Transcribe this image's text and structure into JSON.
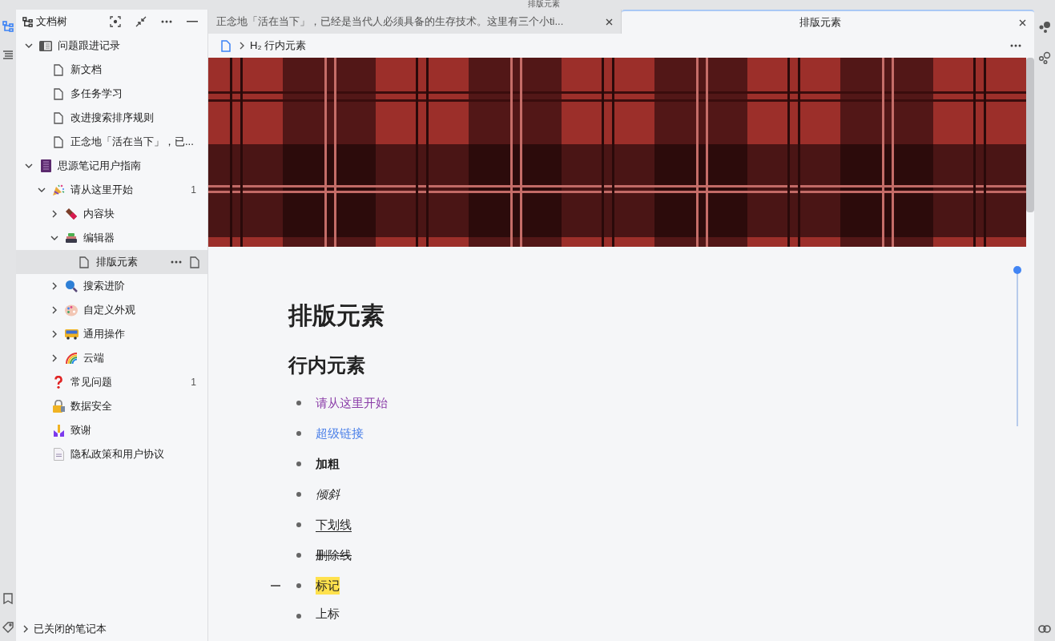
{
  "window": {
    "title": "排版元素"
  },
  "sidebar": {
    "title": "文档树",
    "tree": [
      {
        "label": "问题跟进记录",
        "kind": "notebook",
        "expanded": true,
        "selected": false,
        "children": [
          {
            "label": "新文档",
            "kind": "doc",
            "selected": false
          },
          {
            "label": "多任务学习",
            "kind": "doc",
            "selected": false
          },
          {
            "label": "改进搜索排序规则",
            "kind": "doc",
            "selected": false
          },
          {
            "label": "正念地「活在当下」，已...",
            "kind": "doc",
            "selected": false
          }
        ]
      },
      {
        "label": "思源笔记用户指南",
        "kind": "book",
        "expanded": true,
        "selected": false,
        "children": [
          {
            "label": "请从这里开始",
            "kind": "party",
            "expanded": true,
            "selected": false,
            "count": "1",
            "children": [
              {
                "label": "内容块",
                "kind": "chocolate",
                "expanded": false,
                "selected": false
              },
              {
                "label": "编辑器",
                "kind": "stack",
                "expanded": true,
                "selected": false,
                "children": [
                  {
                    "label": "排版元素",
                    "kind": "doc",
                    "selected": true
                  }
                ]
              },
              {
                "label": "搜索进阶",
                "kind": "magnifier",
                "expanded": false,
                "selected": false
              },
              {
                "label": "自定义外观",
                "kind": "palette",
                "expanded": false,
                "selected": false
              },
              {
                "label": "通用操作",
                "kind": "bus",
                "expanded": false,
                "selected": false
              },
              {
                "label": "云端",
                "kind": "rainbow",
                "expanded": false,
                "selected": false
              }
            ]
          },
          {
            "label": "常见问题",
            "kind": "question",
            "selected": false,
            "count": "1"
          },
          {
            "label": "数据安全",
            "kind": "lock",
            "selected": false
          },
          {
            "label": "致谢",
            "kind": "hands",
            "selected": false
          },
          {
            "label": "隐私政策和用户协议",
            "kind": "page",
            "selected": false
          }
        ]
      }
    ],
    "closed_notebooks": "已关闭的笔记本"
  },
  "tabs": [
    {
      "label": "正念地「活在当下」，已经是当代人必须具备的生存技术。这里有三个小ti...",
      "selected": false
    },
    {
      "label": "排版元素",
      "selected": true
    }
  ],
  "breadcrumb": {
    "heading_mark": "H₂",
    "heading": "行内元素"
  },
  "document": {
    "title": "排版元素",
    "heading": "行内元素",
    "items": [
      {
        "text": "请从这里开始",
        "kind": "ref"
      },
      {
        "text": "超级链接",
        "kind": "link"
      },
      {
        "text": "加粗",
        "kind": "bold"
      },
      {
        "text": "倾斜",
        "kind": "italic"
      },
      {
        "text": "下划线",
        "kind": "underline"
      },
      {
        "text": "删除线",
        "kind": "strike"
      },
      {
        "text": "标记",
        "kind": "mark"
      },
      {
        "text": "上标",
        "kind": "sup"
      }
    ]
  }
}
